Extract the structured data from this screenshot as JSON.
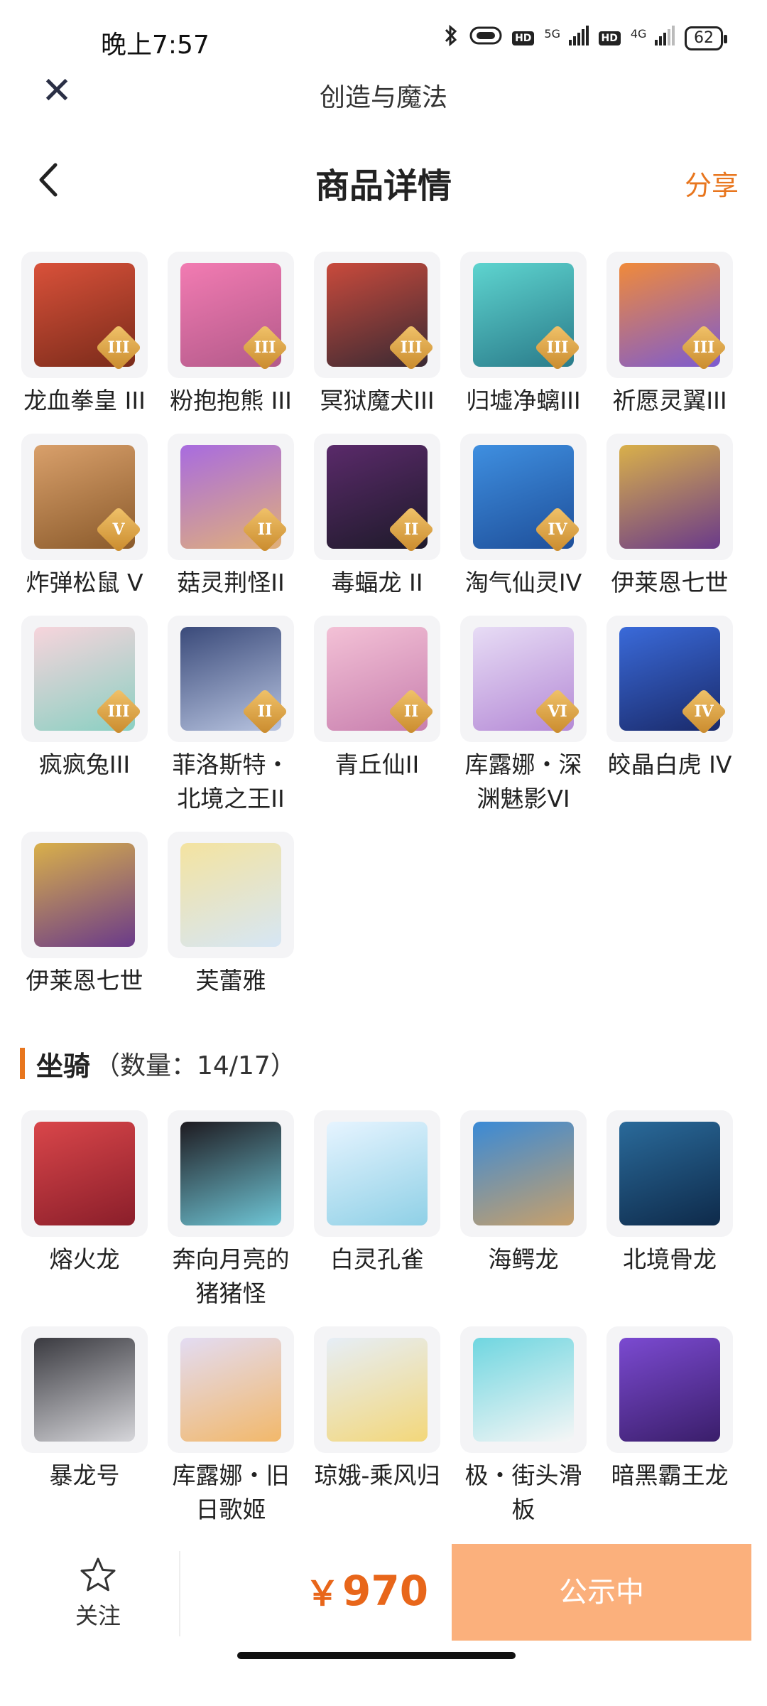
{
  "status_bar": {
    "time": "晚上7:57",
    "net1": "5G",
    "net2": "4G",
    "hd": "HD",
    "battery": "62"
  },
  "webview": {
    "title": "创造与魔法"
  },
  "nav": {
    "title": "商品详情",
    "share": "分享"
  },
  "pets": [
    {
      "name": "龙血拳皇 III",
      "rank": "III",
      "colors": [
        "#d9513a",
        "#7a2b1a"
      ]
    },
    {
      "name": "粉抱抱熊 III",
      "rank": "III",
      "colors": [
        "#f27bb2",
        "#b35a8a"
      ]
    },
    {
      "name": "冥狱魔犬III",
      "rank": "III",
      "colors": [
        "#c94a3c",
        "#3a2a33"
      ]
    },
    {
      "name": "归墟净螭III",
      "rank": "III",
      "colors": [
        "#5ed4cf",
        "#2a7b8a"
      ]
    },
    {
      "name": "祈愿灵翼III",
      "rank": "III",
      "colors": [
        "#f08a3a",
        "#7c5bd1"
      ]
    },
    {
      "name": "炸弹松鼠 V",
      "rank": "V",
      "colors": [
        "#d9a06b",
        "#8a5a2b"
      ]
    },
    {
      "name": "菇灵荆怪II",
      "rank": "II",
      "colors": [
        "#a86be0",
        "#e0b07a"
      ]
    },
    {
      "name": "毒蝠龙 II",
      "rank": "II",
      "colors": [
        "#5a2a6a",
        "#1e1a2a"
      ]
    },
    {
      "name": "淘气仙灵IV",
      "rank": "IV",
      "colors": [
        "#3f8fe0",
        "#1e4f9a"
      ]
    },
    {
      "name": "伊莱恩七世",
      "rank": "",
      "colors": [
        "#d9b04a",
        "#6a3a8a"
      ]
    },
    {
      "name": "疯疯兔III",
      "rank": "III",
      "colors": [
        "#f7d4dc",
        "#8ad0c2"
      ]
    },
    {
      "name": "菲洛斯特・北境之王II",
      "rank": "II",
      "colors": [
        "#3a4a7a",
        "#b8c4e0"
      ]
    },
    {
      "name": "青丘仙II",
      "rank": "II",
      "colors": [
        "#f3c1d6",
        "#c87fae"
      ]
    },
    {
      "name": "库露娜・深渊魅影VI",
      "rank": "VI",
      "colors": [
        "#e7dcf5",
        "#b58ad6"
      ]
    },
    {
      "name": "皎晶白虎 IV",
      "rank": "IV",
      "colors": [
        "#3a6ad9",
        "#1a2a6a"
      ]
    },
    {
      "name": "伊莱恩七世",
      "rank": "",
      "colors": [
        "#d9b04a",
        "#6a3a8a"
      ]
    },
    {
      "name": "芙蕾雅",
      "rank": "",
      "colors": [
        "#f4e3a0",
        "#d6e6f5"
      ]
    }
  ],
  "mounts_section": {
    "title": "坐骑",
    "count": "（数量：14/17）"
  },
  "mounts": [
    {
      "name": "熔火龙",
      "colors": [
        "#d9464a",
        "#8a1e2a"
      ]
    },
    {
      "name": "奔向月亮的猪猪怪",
      "colors": [
        "#1e1a20",
        "#6fc6d6"
      ]
    },
    {
      "name": "白灵孔雀",
      "colors": [
        "#e6f4ff",
        "#8fd0e6"
      ]
    },
    {
      "name": "海鳄龙",
      "colors": [
        "#3a8ad6",
        "#c8a06a"
      ]
    },
    {
      "name": "北境骨龙",
      "colors": [
        "#2a6a9a",
        "#0e2a4a"
      ]
    },
    {
      "name": "暴龙号",
      "colors": [
        "#3a3a40",
        "#d6d6da"
      ]
    },
    {
      "name": "库露娜・旧日歌姬",
      "colors": [
        "#e3dcf3",
        "#f2b86a"
      ]
    },
    {
      "name": "琼娥-乘风归",
      "colors": [
        "#e6eef7",
        "#f3d77a"
      ]
    },
    {
      "name": "极・街头滑板",
      "colors": [
        "#6fd6e0",
        "#f6f6f6"
      ]
    },
    {
      "name": "暗黑霸王龙",
      "colors": [
        "#7b4ad1",
        "#3a1e6a"
      ]
    }
  ],
  "bottom": {
    "follow": "关注",
    "currency": "￥",
    "price": "970",
    "status": "公示中",
    "price_color": "#e8661a",
    "status_bg": "#fbb07c"
  }
}
